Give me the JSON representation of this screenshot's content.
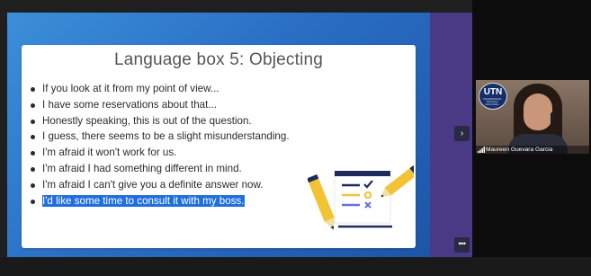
{
  "slide": {
    "title": "Language box 5: Objecting",
    "bullets": [
      "If you look at it from my point of view...",
      "I have some reservations about that...",
      "Honestly speaking, this is out of the question.",
      "I guess, there seems to be a slight misunderstanding.",
      "I'm afraid it won't work for us.",
      "I'm afraid I had something different in mind.",
      "I'm afraid I can't give you a definite answer now.",
      "I'd like some time to consult it with my boss."
    ],
    "selected_index": 7
  },
  "participant": {
    "name": "Maureen Guevara Garcia",
    "logo_text": "UTN",
    "logo_subtext": "UNIVERSIDAD TÉCNICA NACIONAL"
  },
  "controls": {
    "next_glyph": "›",
    "more_glyph": "•••"
  },
  "colors": {
    "stage": "#2a6fc5",
    "sidebar": "#4a3a86",
    "selection": "#1f6fe0",
    "illustration_yellow": "#f2c335",
    "illustration_navy": "#1d2a5c"
  }
}
